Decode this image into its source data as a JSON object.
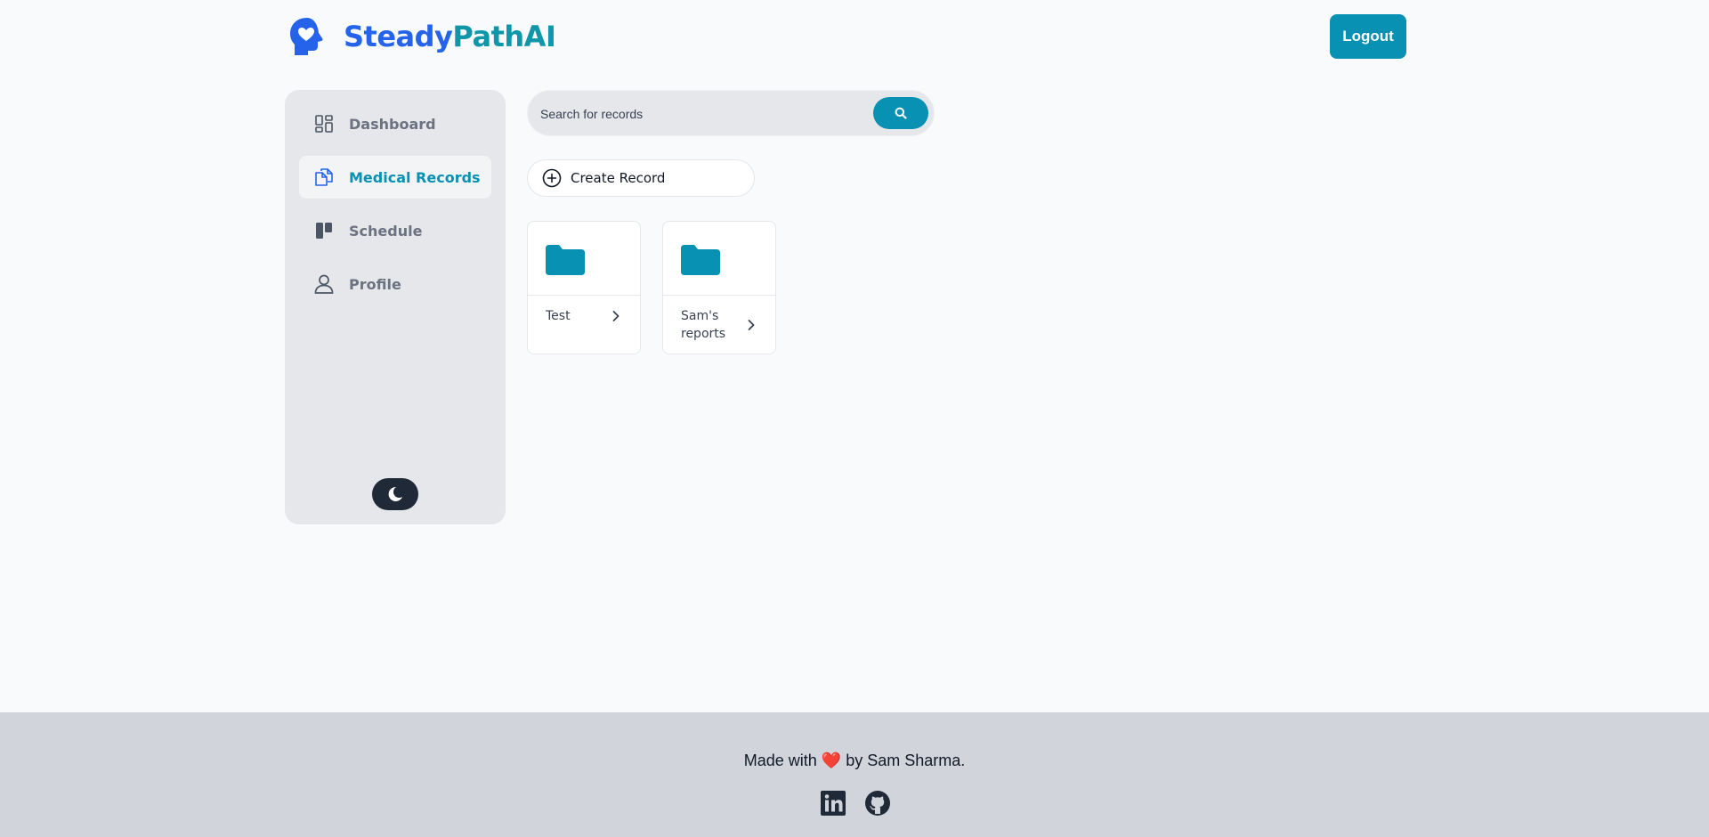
{
  "header": {
    "brand_part1": "Steady",
    "brand_part2": "PathAI",
    "logout_label": "Logout"
  },
  "sidebar": {
    "items": [
      {
        "label": "Dashboard",
        "icon": "dashboard-icon",
        "active": false
      },
      {
        "label": "Medical Records",
        "icon": "documents-icon",
        "active": true
      },
      {
        "label": "Schedule",
        "icon": "schedule-icon",
        "active": false
      },
      {
        "label": "Profile",
        "icon": "user-icon",
        "active": false
      }
    ],
    "theme_toggle_icon": "moon-icon"
  },
  "search": {
    "placeholder": "Search for records",
    "value": ""
  },
  "create_record_label": "Create Record",
  "folders": [
    {
      "name": "Test"
    },
    {
      "name": "Sam's reports"
    }
  ],
  "footer": {
    "text_before": "Made with ",
    "heart": "❤️",
    "text_after": " by Sam Sharma.",
    "social_icons": [
      "linkedin-icon",
      "github-icon"
    ]
  },
  "colors": {
    "accent": "#0891b2",
    "brand_blue": "#2563eb",
    "brand_teal": "#0f96a8",
    "sidebar_bg": "#e5e7eb",
    "footer_bg": "#d1d5db"
  }
}
